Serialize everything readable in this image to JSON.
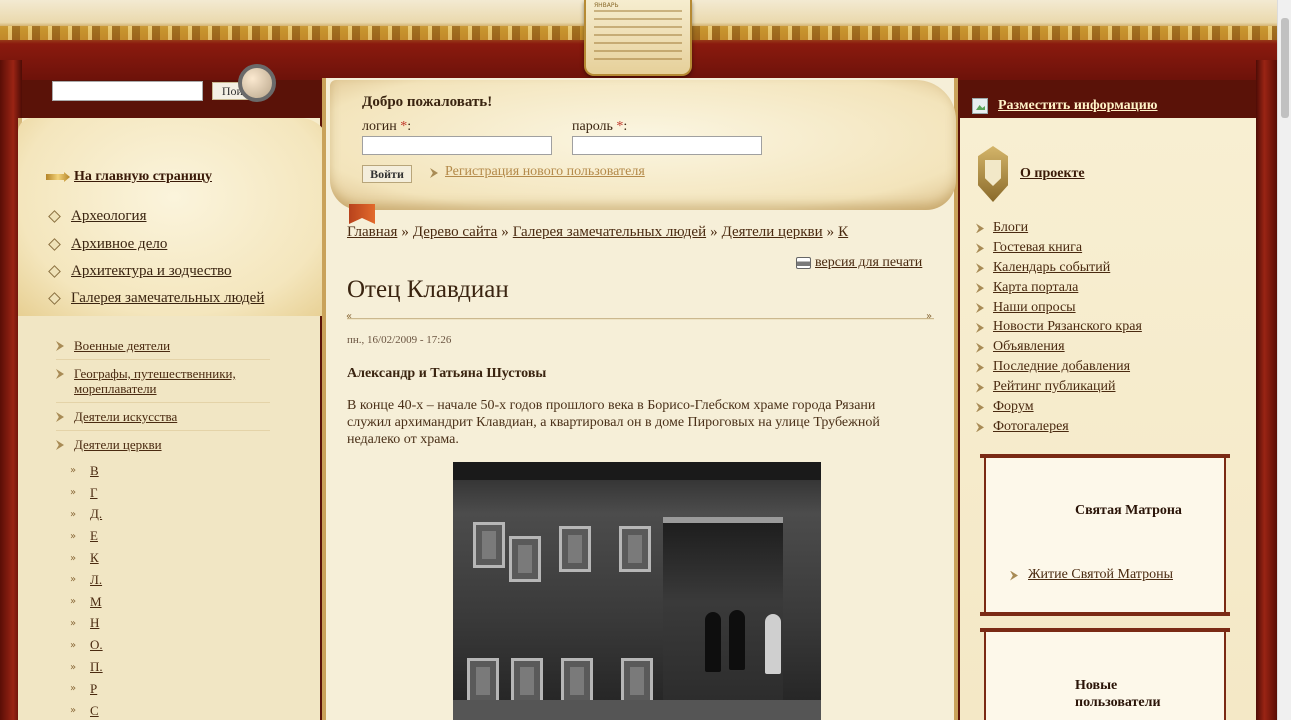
{
  "calendar": {
    "month": "ЯНВАРЬ"
  },
  "search": {
    "button": "Поиск",
    "value": ""
  },
  "left": {
    "home_link": "На главную страницу",
    "categories": [
      "Археология",
      "Архивное дело",
      "Архитектура и зодчество",
      "Галерея замечательных людей"
    ],
    "subcategories": [
      "Военные деятели",
      "Географы, путешественники, мореплаватели",
      "Деятели искусства",
      "Деятели церкви"
    ],
    "letters": [
      "В",
      "Г",
      "Д.",
      "Е",
      "К",
      "Л.",
      "М",
      "Н",
      "О.",
      "П.",
      "Р",
      "С"
    ]
  },
  "login": {
    "welcome": "Добро пожаловать!",
    "login_label": "логин",
    "password_label": "пароль",
    "required_mark": "*",
    "colon": ":",
    "submit": "Войти",
    "register": "Регистрация нового пользователя"
  },
  "breadcrumb": {
    "items": [
      "Главная",
      "Дерево сайта",
      "Галерея замечательных людей",
      "Деятели церкви",
      "К"
    ],
    "separator": "»"
  },
  "article": {
    "print_link": "версия для печати",
    "title": "Отец Клавдиан",
    "date": "пн., 16/02/2009 - 17:26",
    "author": "Александр и Татьяна Шустовы",
    "text": "В конце 40-х – начале 50-х годов прошлого века в Борисо-Глебском храме города Рязани служил архимандрит Клавдиан, а квартировал он в доме Пироговых на улице Трубежной недалеко от храма.",
    "rule_left": "«",
    "rule_right": "»"
  },
  "right": {
    "place_info": "Разместить информацию",
    "about": "О проекте",
    "links": [
      "Блоги",
      "Гостевая книга",
      "Календарь событий",
      "Карта портала",
      "Наши опросы",
      "Новости Рязанского края",
      "Объявления",
      "Последние добавления",
      "Рейтинг публикаций",
      "Форум",
      "Фотогалерея"
    ],
    "matrona_title": "Святая Матрона",
    "matrona_link": "Житие Святой Матроны",
    "new_users_title": "Новые пользователи"
  },
  "colors": {
    "curtain": "#8a1a0e",
    "parchment": "#f6efd8",
    "text": "#3a2410",
    "link_muted": "#b48a4a",
    "required": "#c0392b"
  }
}
